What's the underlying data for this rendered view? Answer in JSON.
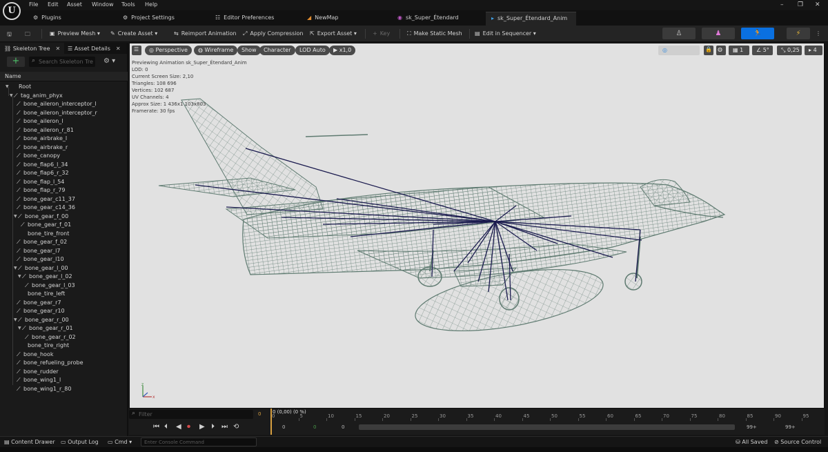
{
  "menubar": {
    "logo": "U",
    "items": [
      "File",
      "Edit",
      "Asset",
      "Window",
      "Tools",
      "Help"
    ],
    "window_controls": [
      "–",
      "❐",
      "✕"
    ]
  },
  "tabs": [
    {
      "label": "Plugins",
      "icon": "plug-icon"
    },
    {
      "label": "Project Settings",
      "icon": "settings-icon"
    },
    {
      "label": "Editor Preferences",
      "icon": "sliders-icon"
    },
    {
      "label": "NewMap",
      "icon": "level-icon"
    },
    {
      "label": "sk_Super_Étendard",
      "icon": "skeleton-icon"
    },
    {
      "label": "sk_Super_Étendard_Anim",
      "icon": "anim-icon",
      "close": "✕"
    }
  ],
  "toolbar": {
    "preview_mesh": "Preview Mesh",
    "create_asset": "Create Asset",
    "reimport_animation": "Reimport Animation",
    "apply_compression": "Apply Compression",
    "export_asset": "Export Asset",
    "key": "Key",
    "make_static_mesh": "Make Static Mesh",
    "edit_in_sequencer": "Edit in Sequencer"
  },
  "left_panel": {
    "tabs": [
      "Skeleton Tree",
      "Asset Details"
    ],
    "search_placeholder": "Search Skeleton Tre",
    "column_header": "Name",
    "tree": [
      {
        "label": "Root",
        "depth": 0,
        "expand": true,
        "bone": false
      },
      {
        "label": "tag_anim_phyx",
        "depth": 1,
        "expand": true,
        "bone": true
      },
      {
        "label": "bone_aileron_interceptor_l",
        "depth": 2,
        "expand": false,
        "bone": true
      },
      {
        "label": "bone_aileron_interceptor_r",
        "depth": 2,
        "expand": false,
        "bone": true
      },
      {
        "label": "bone_aileron_l",
        "depth": 2,
        "expand": false,
        "bone": true
      },
      {
        "label": "bone_aileron_r_81",
        "depth": 2,
        "expand": false,
        "bone": true
      },
      {
        "label": "bone_airbrake_l",
        "depth": 2,
        "expand": false,
        "bone": true
      },
      {
        "label": "bone_airbrake_r",
        "depth": 2,
        "expand": false,
        "bone": true
      },
      {
        "label": "bone_canopy",
        "depth": 2,
        "expand": false,
        "bone": true
      },
      {
        "label": "bone_flap6_l_34",
        "depth": 2,
        "expand": false,
        "bone": true
      },
      {
        "label": "bone_flap6_r_32",
        "depth": 2,
        "expand": false,
        "bone": true
      },
      {
        "label": "bone_flap_l_54",
        "depth": 2,
        "expand": false,
        "bone": true
      },
      {
        "label": "bone_flap_r_79",
        "depth": 2,
        "expand": false,
        "bone": true
      },
      {
        "label": "bone_gear_c11_37",
        "depth": 2,
        "expand": false,
        "bone": true
      },
      {
        "label": "bone_gear_c14_36",
        "depth": 2,
        "expand": false,
        "bone": true
      },
      {
        "label": "bone_gear_f_00",
        "depth": 2,
        "expand": true,
        "bone": true
      },
      {
        "label": "bone_gear_f_01",
        "depth": 3,
        "expand": false,
        "bone": true
      },
      {
        "label": "bone_tire_front",
        "depth": 3,
        "expand": false,
        "bone": false
      },
      {
        "label": "bone_gear_f_02",
        "depth": 2,
        "expand": false,
        "bone": true
      },
      {
        "label": "bone_gear_l7",
        "depth": 2,
        "expand": false,
        "bone": true
      },
      {
        "label": "bone_gear_l10",
        "depth": 2,
        "expand": false,
        "bone": true
      },
      {
        "label": "bone_gear_l_00",
        "depth": 2,
        "expand": true,
        "bone": true
      },
      {
        "label": "bone_gear_l_02",
        "depth": 3,
        "expand": true,
        "bone": true
      },
      {
        "label": "bone_gear_l_03",
        "depth": 4,
        "expand": false,
        "bone": true
      },
      {
        "label": "bone_tire_left",
        "depth": 3,
        "expand": false,
        "bone": false
      },
      {
        "label": "bone_gear_r7",
        "depth": 2,
        "expand": false,
        "bone": true
      },
      {
        "label": "bone_gear_r10",
        "depth": 2,
        "expand": false,
        "bone": true
      },
      {
        "label": "bone_gear_r_00",
        "depth": 2,
        "expand": true,
        "bone": true
      },
      {
        "label": "bone_gear_r_01",
        "depth": 3,
        "expand": true,
        "bone": true
      },
      {
        "label": "bone_gear_r_02",
        "depth": 4,
        "expand": false,
        "bone": true
      },
      {
        "label": "bone_tire_right",
        "depth": 3,
        "expand": false,
        "bone": false
      },
      {
        "label": "bone_hook",
        "depth": 2,
        "expand": false,
        "bone": true
      },
      {
        "label": "bone_refueling_probe",
        "depth": 2,
        "expand": false,
        "bone": true
      },
      {
        "label": "bone_rudder",
        "depth": 2,
        "expand": false,
        "bone": true
      },
      {
        "label": "bone_wing1_l",
        "depth": 2,
        "expand": false,
        "bone": true
      },
      {
        "label": "bone_wing1_r_80",
        "depth": 2,
        "expand": false,
        "bone": true
      }
    ]
  },
  "viewport": {
    "toolbar": {
      "perspective": "Perspective",
      "wireframe": "Wireframe",
      "show": "Show",
      "character": "Character",
      "lod": "LOD Auto",
      "speed": "x1,0",
      "fov": "5°",
      "scale": "0,25",
      "cam_speed": "4",
      "grid": "1"
    },
    "stats": [
      "Previewing Animation sk_Super_Étendard_Anim",
      "LOD: 0",
      "Current Screen Size: 2,10",
      "Triangles: 108 696",
      "Vertices: 102 687",
      "UV Channels: 4",
      "Approx Size: 1 436x1 103x803",
      "Framerate: 30 fps"
    ],
    "mesh_color": "#5e7a70",
    "bone_color": "#1a1a4e"
  },
  "timeline": {
    "filter_placeholder": "Filter",
    "start_value": "0",
    "current_frame": "0 (0,00) (0 %)",
    "ticks": [
      "0",
      "5",
      "10",
      "15",
      "20",
      "25",
      "30",
      "35",
      "40",
      "45",
      "50",
      "55",
      "60",
      "65",
      "70",
      "75",
      "80",
      "85",
      "90",
      "95"
    ],
    "left_nums": [
      "0",
      "0",
      "0"
    ],
    "right_nums": [
      "99+",
      "99+"
    ],
    "playback_progress": 0.0
  },
  "statusbar": {
    "content_drawer": "Content Drawer",
    "output_log": "Output Log",
    "cmd": "Cmd",
    "console_placeholder": "Enter Console Command",
    "all_saved": "All Saved",
    "source_control": "Source Control"
  }
}
